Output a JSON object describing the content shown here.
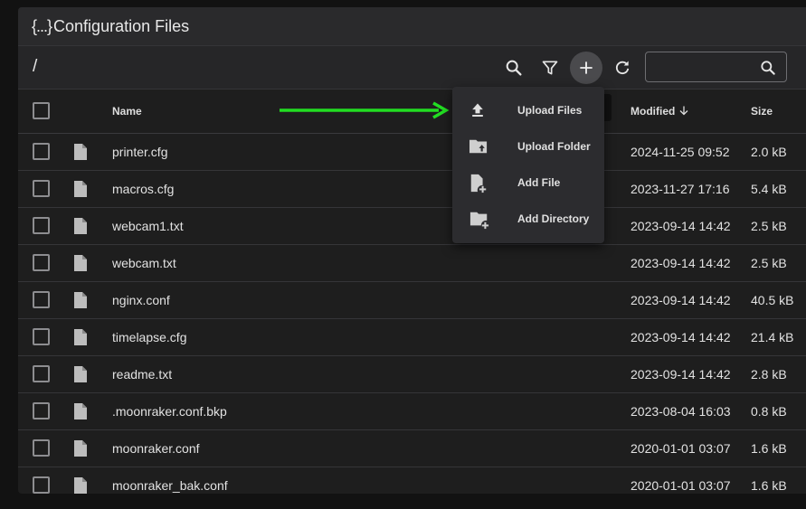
{
  "panel": {
    "title_brace": "{...}",
    "title": "Configuration Files"
  },
  "toolbar": {
    "path": "/",
    "search_placeholder": "",
    "icons": [
      "magnify-icon",
      "filter-icon",
      "plus-icon",
      "refresh-icon",
      "search-icon"
    ]
  },
  "table": {
    "headers": {
      "name": "Name",
      "modified": "Modified",
      "size": "Size"
    },
    "sort": {
      "column": "modified",
      "direction": "desc"
    },
    "rows": [
      {
        "name": "printer.cfg",
        "modified": "2024-11-25 09:52",
        "size": "2.0 kB"
      },
      {
        "name": "macros.cfg",
        "modified": "2023-11-27 17:16",
        "size": "5.4 kB"
      },
      {
        "name": "webcam1.txt",
        "modified": "2023-09-14 14:42",
        "size": "2.5 kB"
      },
      {
        "name": "webcam.txt",
        "modified": "2023-09-14 14:42",
        "size": "2.5 kB"
      },
      {
        "name": "nginx.conf",
        "modified": "2023-09-14 14:42",
        "size": "40.5 kB"
      },
      {
        "name": "timelapse.cfg",
        "modified": "2023-09-14 14:42",
        "size": "21.4 kB"
      },
      {
        "name": "readme.txt",
        "modified": "2023-09-14 14:42",
        "size": "2.8 kB"
      },
      {
        "name": ".moonraker.conf.bkp",
        "modified": "2023-08-04 16:03",
        "size": "0.8 kB"
      },
      {
        "name": "moonraker.conf",
        "modified": "2020-01-01 03:07",
        "size": "1.6 kB"
      },
      {
        "name": "moonraker_bak.conf",
        "modified": "2020-01-01 03:07",
        "size": "1.6 kB"
      }
    ]
  },
  "add_menu": {
    "items": [
      {
        "label": "Upload Files",
        "icon": "upload-icon"
      },
      {
        "label": "Upload Folder",
        "icon": "folder-upload-icon"
      },
      {
        "label": "Add File",
        "icon": "file-plus-icon"
      },
      {
        "label": "Add Directory",
        "icon": "folder-plus-icon"
      }
    ]
  },
  "colors": {
    "background": "#121212",
    "panel": "#1e1e1e",
    "title_bar": "#2a2a2c",
    "menu": "#2c2c2f",
    "arrow": "#22dd22",
    "icon": "#bdbdbd"
  }
}
